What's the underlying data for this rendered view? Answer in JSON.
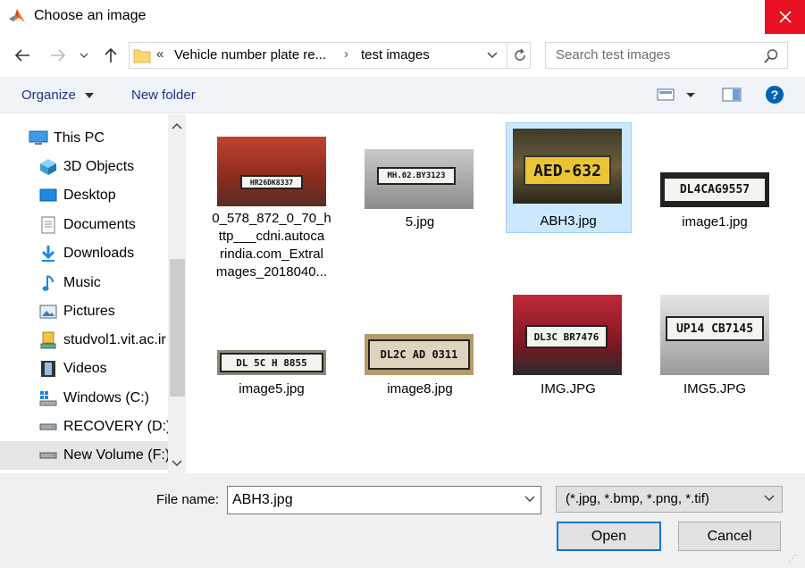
{
  "window": {
    "title": "Choose an image",
    "close_icon": "close-icon"
  },
  "address_bar": {
    "overflow": "«",
    "crumbs": [
      "Vehicle number plate re...",
      "test images"
    ],
    "separator": "›"
  },
  "search": {
    "placeholder": "Search test images"
  },
  "toolbar": {
    "organize_label": "Organize",
    "new_folder_label": "New folder"
  },
  "nav_pane": {
    "items": [
      {
        "label": "This PC",
        "icon": "computer-icon"
      },
      {
        "label": "3D Objects",
        "icon": "3d-objects-icon"
      },
      {
        "label": "Desktop",
        "icon": "desktop-icon"
      },
      {
        "label": "Documents",
        "icon": "documents-icon"
      },
      {
        "label": "Downloads",
        "icon": "downloads-icon"
      },
      {
        "label": "Music",
        "icon": "music-icon"
      },
      {
        "label": "Pictures",
        "icon": "pictures-icon"
      },
      {
        "label": "studvol1.vit.ac.ir",
        "icon": "network-drive-icon"
      },
      {
        "label": "Videos",
        "icon": "videos-icon"
      },
      {
        "label": "Windows (C:)",
        "icon": "windows-drive-icon"
      },
      {
        "label": "RECOVERY (D:)",
        "icon": "drive-icon"
      },
      {
        "label": "New Volume (F:)",
        "icon": "drive-icon"
      }
    ],
    "selected_index": 11
  },
  "files": [
    {
      "name": "0_578_872_0_70_http___cdni.autocarindia.com_ExtraImages_2018040...",
      "name_lines": [
        "0_578_872_0_70_h",
        "ttp___cdni.autoca",
        "rindia.com_Extral",
        "mages_2018040..."
      ],
      "plate": "HR26DK8337",
      "selected": false
    },
    {
      "name": "5.jpg",
      "plate": "MH.02.BY3123",
      "selected": false
    },
    {
      "name": "ABH3.jpg",
      "plate": "AED-632",
      "selected": true
    },
    {
      "name": "image1.jpg",
      "plate": "DL4CAG9557",
      "selected": false
    },
    {
      "name": "image5.jpg",
      "plate": "DL 5C H 8855",
      "selected": false
    },
    {
      "name": "image8.jpg",
      "plate": "DL2C AD 0311",
      "selected": false
    },
    {
      "name": "IMG.JPG",
      "plate": "DL3C BR7476",
      "selected": false
    },
    {
      "name": "IMG5.JPG",
      "plate": "UP14 CB7145",
      "selected": false
    }
  ],
  "bottom": {
    "file_name_label": "File name:",
    "file_name_value": "ABH3.jpg",
    "file_type_value": "(*.jpg, *.bmp, *.png, *.tif)",
    "open_label": "Open",
    "cancel_label": "Cancel"
  },
  "colors": {
    "close_red": "#e81123",
    "selection_fill": "#cce8ff",
    "selection_border": "#99d1ff",
    "link_blue": "#1e3287",
    "help_blue": "#0063b1",
    "default_button_border": "#0078d7"
  }
}
